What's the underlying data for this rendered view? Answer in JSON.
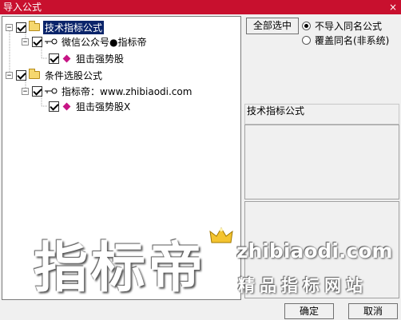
{
  "window": {
    "title": "导入公式",
    "close_glyph": "×"
  },
  "tree": {
    "groups": [
      {
        "label": "技术指标公式",
        "checked": true,
        "selected": true,
        "expander": "−",
        "children": [
          {
            "label": "微信公众号●指标帝",
            "checked": true,
            "expander": "−",
            "children": [
              {
                "label": "狙击强势股",
                "checked": true
              }
            ]
          }
        ]
      },
      {
        "label": "条件选股公式",
        "checked": true,
        "selected": false,
        "expander": "−",
        "children": [
          {
            "label": "指标帝：www.zhibiaodi.com",
            "checked": true,
            "expander": "−",
            "children": [
              {
                "label": "狙击强势股X",
                "checked": true
              }
            ]
          }
        ]
      }
    ]
  },
  "options": {
    "select_all_label": "全部选中",
    "radio_no_import": "不导入同名公式",
    "radio_overwrite": "覆盖同名(非系统)",
    "selected_radio": "no_import"
  },
  "info": {
    "group_label": "技术指标公式"
  },
  "footer": {
    "ok_label": "确定",
    "cancel_label": "取消"
  },
  "watermark": {
    "brand": "指标帝",
    "url": "zhibiaodi.com",
    "tagline": "精品指标网站"
  }
}
